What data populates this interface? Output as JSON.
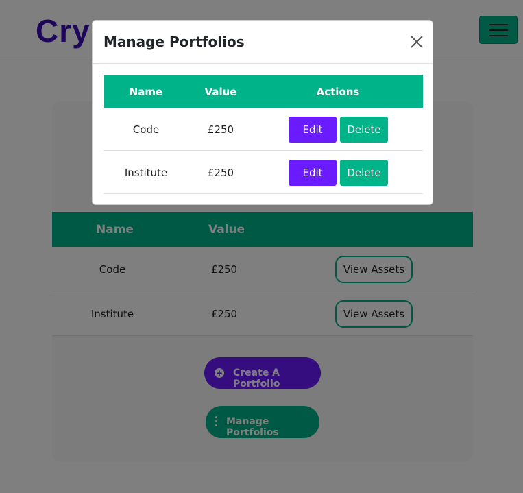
{
  "colors": {
    "brand_purple": "#3c0fb5",
    "accent_green": "#00b388",
    "accent_purple": "#6a1bff",
    "overlay": "rgba(0,0,0,0.5)"
  },
  "navbar": {
    "brand_text": "Crypto",
    "toggler_icon": "hamburger-menu-icon"
  },
  "portfolio_table": {
    "headers": {
      "name": "Name",
      "value": "Value"
    },
    "rows": [
      {
        "name": "Code",
        "value": "£250",
        "action": "View Assets"
      },
      {
        "name": "Institute",
        "value": "£250",
        "action": "View Assets"
      }
    ]
  },
  "actions": {
    "create_label": "Create A Portfolio",
    "create_icon": "plus-circle-icon",
    "manage_label": "Manage Portfolios",
    "manage_icon": "vertical-ellipsis-icon"
  },
  "modal": {
    "title": "Manage Portfolios",
    "close_icon": "close-icon",
    "headers": {
      "name": "Name",
      "value": "Value",
      "actions": "Actions"
    },
    "rows": [
      {
        "name": "Code",
        "value": "£250",
        "edit": "Edit",
        "delete": "Delete"
      },
      {
        "name": "Institute",
        "value": "£250",
        "edit": "Edit",
        "delete": "Delete"
      }
    ]
  }
}
